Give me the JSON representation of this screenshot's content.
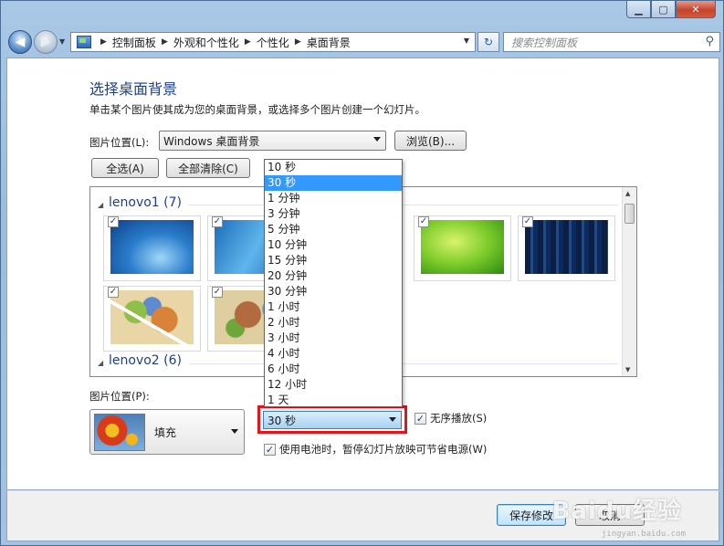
{
  "nav": {
    "breadcrumbs": [
      "控制面板",
      "外观和个性化",
      "个性化",
      "桌面背景"
    ],
    "search_placeholder": "搜索控制面板"
  },
  "heading": "选择桌面背景",
  "subtitle": "单击某个图片使其成为您的桌面背景，或选择多个图片创建一个幻灯片。",
  "location": {
    "label": "图片位置(L):",
    "value": "Windows 桌面背景",
    "browse": "浏览(B)..."
  },
  "buttons": {
    "select_all": "全选(A)",
    "clear_all": "全部清除(C)"
  },
  "groups": [
    {
      "name": "lenovo1 (7)"
    },
    {
      "name": "lenovo2 (6)"
    }
  ],
  "position": {
    "label": "图片位置(P):",
    "value": "填充"
  },
  "interval": {
    "value": "30 秒",
    "options": [
      "10 秒",
      "30 秒",
      "1 分钟",
      "3 分钟",
      "5 分钟",
      "10 分钟",
      "15 分钟",
      "20 分钟",
      "30 分钟",
      "1 小时",
      "2 小时",
      "3 小时",
      "4 小时",
      "6 小时",
      "12 小时",
      "1 天"
    ],
    "selected_index": 1
  },
  "shuffle": {
    "label": "无序播放(S)",
    "checked": true
  },
  "battery": {
    "label": "使用电池时，暂停幻灯片放映可节省电源(W)",
    "checked": true
  },
  "footer": {
    "save": "保存修改",
    "cancel": "取消"
  },
  "watermark": {
    "text": "Baidu经验",
    "url": "jingyan.baidu.com"
  },
  "icons": [
    "back-arrow-icon",
    "forward-arrow-icon",
    "control-panel-icon",
    "refresh-icon",
    "search-icon",
    "minimize-icon",
    "maximize-icon",
    "close-icon",
    "checkmark-icon"
  ]
}
